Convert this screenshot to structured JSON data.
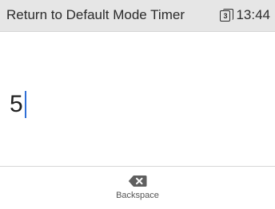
{
  "header": {
    "title": "Return to Default Mode Timer",
    "sim_slot": "3",
    "time": "13:44"
  },
  "input": {
    "value": "5"
  },
  "softkeys": {
    "center_label": "Backspace",
    "center_icon": "backspace-icon"
  },
  "colors": {
    "caret": "#2f6fd6",
    "header_bg": "#e6e6e6"
  }
}
